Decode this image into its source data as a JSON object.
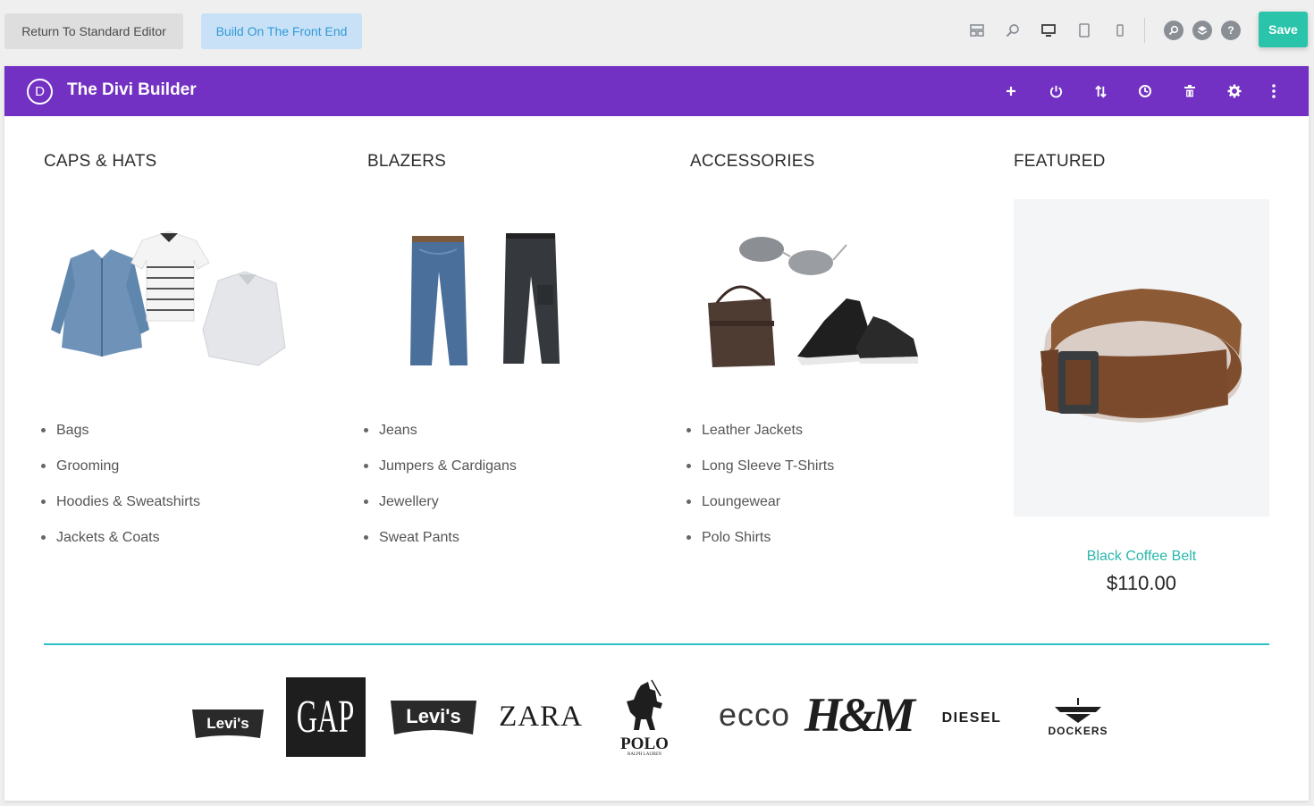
{
  "topbar": {
    "standard_editor_label": "Return To Standard Editor",
    "front_end_label": "Build On The Front End",
    "save_label": "Save",
    "icons": [
      "layout-icon",
      "zoom-icon",
      "desktop-icon",
      "tablet-icon",
      "phone-icon",
      "search-icon",
      "layers-icon",
      "help-icon"
    ],
    "help_glyph": "?"
  },
  "builder": {
    "logo_letter": "D",
    "title": "The Divi Builder",
    "icons": [
      "plus-icon",
      "power-icon",
      "sort-icon",
      "history-icon",
      "trash-icon",
      "gear-icon",
      "more-icon"
    ]
  },
  "columns": [
    {
      "title": "CAPS & HATS",
      "image": "clothing-shirts-image",
      "items": [
        "Bags",
        "Grooming",
        "Hoodies & Sweatshirts",
        "Jackets & Coats"
      ]
    },
    {
      "title": "BLAZERS",
      "image": "jeans-image",
      "items": [
        "Jeans",
        "Jumpers & Cardigans",
        "Jewellery",
        "Sweat Pants"
      ]
    },
    {
      "title": "ACCESSORIES",
      "image": "accessories-image",
      "items": [
        "Leather Jackets",
        "Long Sleeve T-Shirts",
        "Loungewear",
        "Polo Shirts"
      ]
    }
  ],
  "featured": {
    "title": "FEATURED",
    "product_name": "Black Coffee Belt",
    "price": "$110.00",
    "image": "belt-image"
  },
  "brands": [
    "Levi's",
    "GAP",
    "Levi's",
    "ZARA",
    "POLO",
    "ecco",
    "H&M",
    "DIESEL",
    "DOCKERS"
  ],
  "brand_subtext": {
    "polo": "RALPH LAUREN"
  },
  "colors": {
    "purple": "#7231c2",
    "save": "#29c4a9",
    "accent": "#2ac0c5",
    "product_link": "#2ab7ac"
  }
}
